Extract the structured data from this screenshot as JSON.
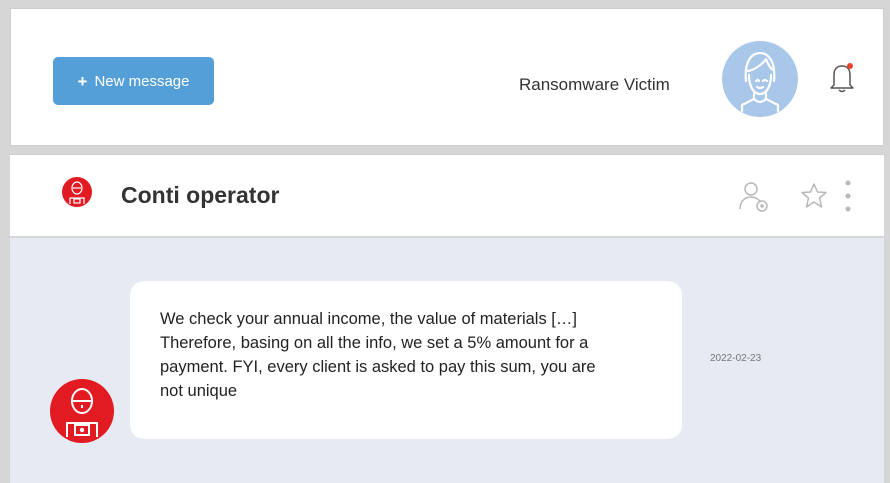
{
  "toolbar": {
    "new_message_icon": "+",
    "new_message_label": "New message"
  },
  "user": {
    "name": "Ransomware Victim",
    "avatar_icon": "user-avatar-icon",
    "avatar_color": "#a9c7e8"
  },
  "notifications": {
    "icon": "bell-icon",
    "badge_color": "#e8452f"
  },
  "chat": {
    "title": "Conti operator",
    "avatar_icon": "operator-avatar-icon",
    "avatar_color": "#e21b22",
    "actions": [
      "add-user-icon",
      "star-icon",
      "more-icon"
    ]
  },
  "messages": [
    {
      "text_lines": [
        "We check your annual income, the value of materials […]",
        "Therefore, basing on all the info, we set a 5% amount for a",
        "payment. FYI, every client is asked to pay this sum, you are",
        "not unique"
      ],
      "date": "2022-02-23"
    }
  ],
  "colors": {
    "accent": "#559fd9",
    "chat_background": "#e6eaf2"
  }
}
